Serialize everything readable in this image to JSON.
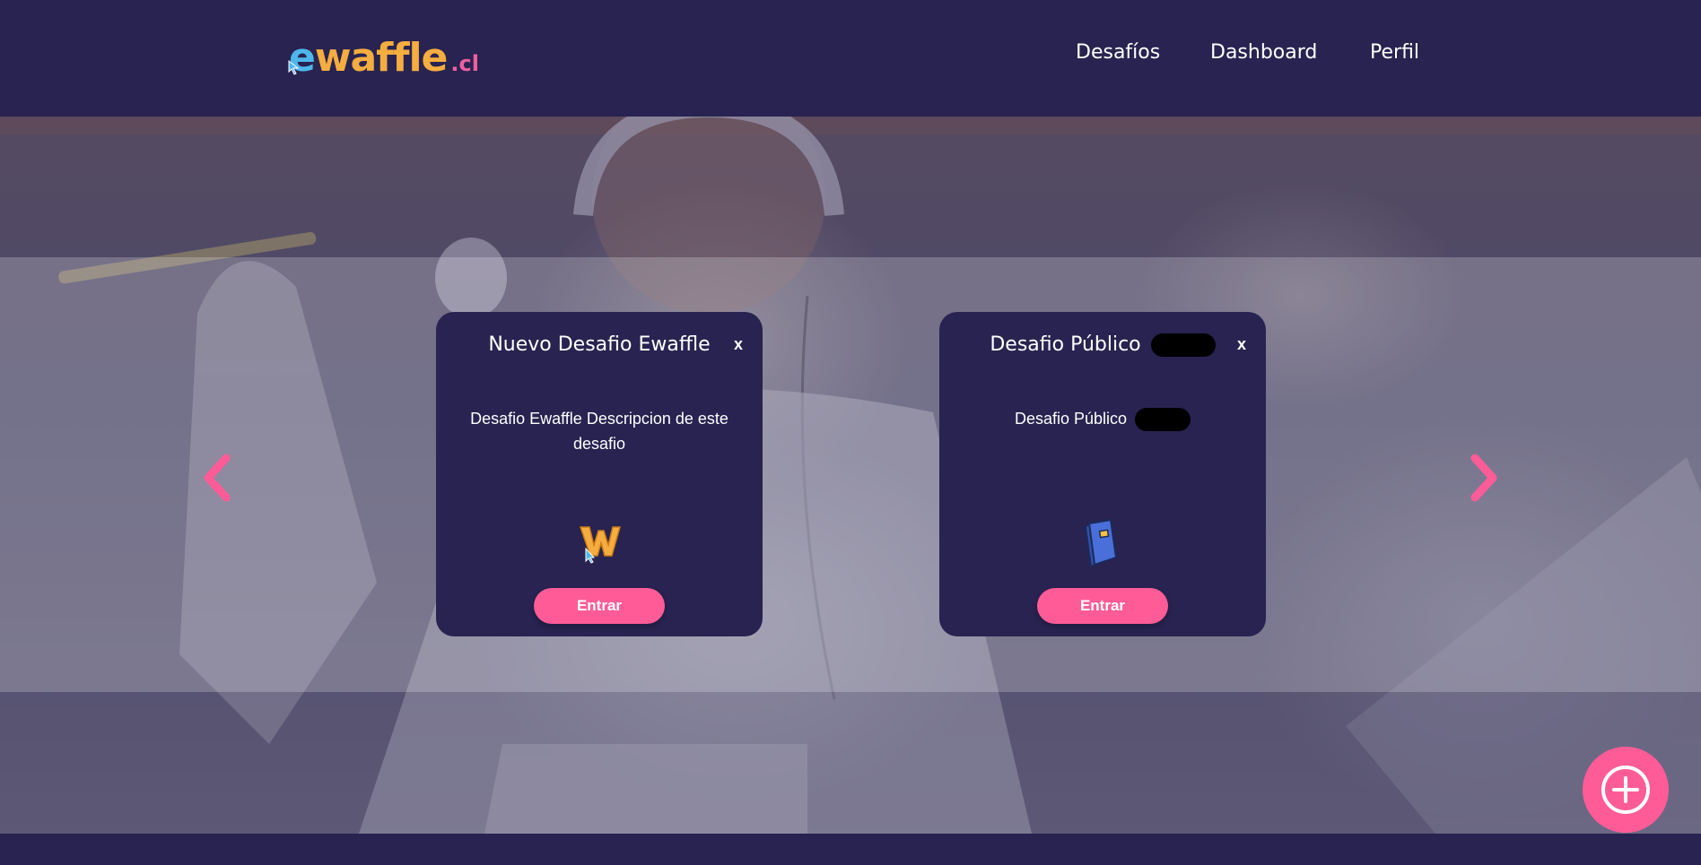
{
  "brand": {
    "logo_e": "e",
    "logo_rest": "waffle",
    "logo_tld": ".cl"
  },
  "nav": {
    "items": [
      {
        "label": "Desafíos"
      },
      {
        "label": "Dashboard"
      },
      {
        "label": "Perfil"
      }
    ]
  },
  "carousel": {
    "prev_icon": "chevron-left-icon",
    "next_icon": "chevron-right-icon",
    "cards": [
      {
        "title": "Nuevo Desafio Ewaffle",
        "close": "x",
        "description": "Desafio Ewaffle Descripcion de este desafio",
        "icon": "ewaffle-w-icon",
        "button": "Entrar"
      },
      {
        "title": "Desafio Público",
        "close": "x",
        "description": "Desafio Público",
        "icon": "book-icon",
        "button": "Entrar"
      }
    ]
  },
  "fab": {
    "icon": "plus-circle-icon"
  },
  "colors": {
    "navy": "#282350",
    "pink": "#ff5c97",
    "logo_blue": "#4fb6ea",
    "logo_orange": "#f6ad3f"
  }
}
